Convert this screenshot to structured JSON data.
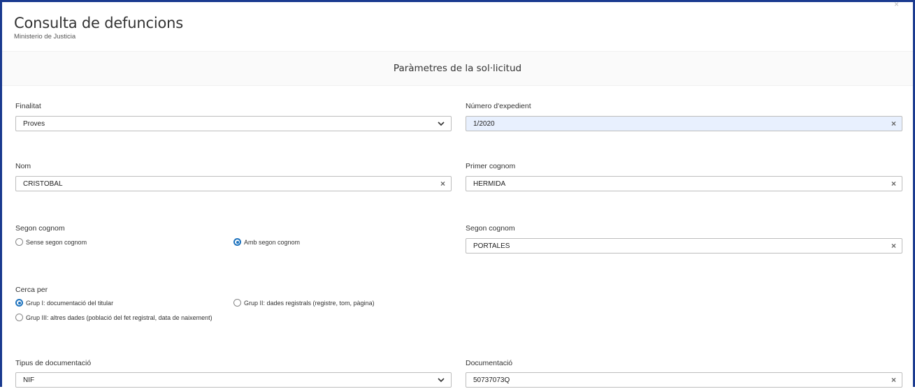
{
  "header": {
    "title": "Consulta de defuncions",
    "subtitle": "Ministerio de Justicia",
    "close_glyph": "×"
  },
  "section": {
    "title": "Paràmetres de la sol·licitud"
  },
  "form": {
    "finalitat": {
      "label": "Finalitat",
      "value": "Proves"
    },
    "numero_expedient": {
      "label": "Número d'expedient",
      "value": "1/2020"
    },
    "nom": {
      "label": "Nom",
      "value": "CRISTOBAL"
    },
    "primer_cognom": {
      "label": "Primer cognom",
      "value": "HERMIDA"
    },
    "segon_cognom_opt": {
      "label": "Segon cognom",
      "options": [
        "Sense segon cognom",
        "Amb segon cognom"
      ],
      "selected": "Amb segon cognom"
    },
    "segon_cognom": {
      "label": "Segon cognom",
      "value": "PORTALES"
    },
    "cerca_per": {
      "label": "Cerca per",
      "options": [
        "Grup I: documentació del titular",
        "Grup II: dades registrals (registre, tom, pàgina)",
        "Grup III: altres dades (població del fet registral, data de naixement)"
      ],
      "selected": "Grup I: documentació del titular"
    },
    "tipus_documentacio": {
      "label": "Tipus de documentació",
      "value": "NIF"
    },
    "documentacio": {
      "label": "Documentació",
      "value": "50737073Q"
    }
  },
  "icons": {
    "clear": "×",
    "dropdown": "chevron-down-icon"
  },
  "colors": {
    "frame": "#1a3a8f",
    "accent": "#1e73be",
    "filled_bg": "#e8f0fe"
  }
}
